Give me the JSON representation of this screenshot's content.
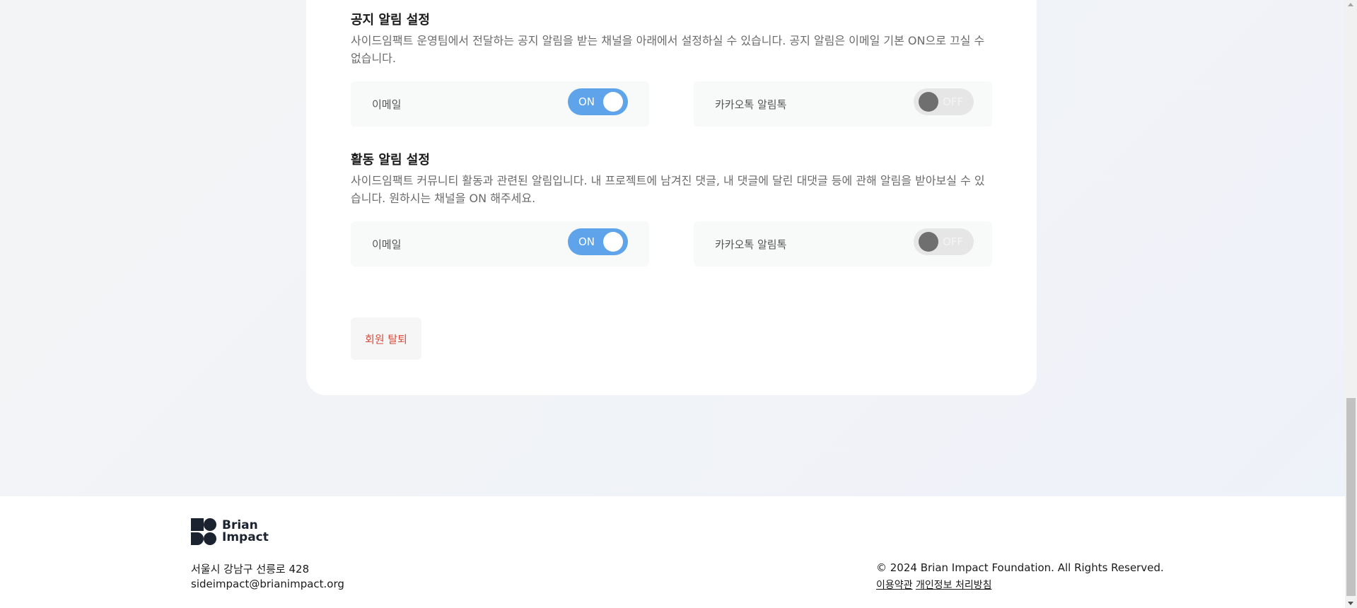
{
  "notice": {
    "title": "공지 알림 설정",
    "desc": "사이드임팩트 운영팀에서 전달하는 공지 알림을 받는 채널을 아래에서 설정하실 수 있습니다. 공지 알림은 이메일 기본 ON으로 끄실 수 없습니다.",
    "email": {
      "label": "이메일",
      "state": "ON"
    },
    "kakao": {
      "label": "카카오톡 알림톡",
      "state": "OFF"
    }
  },
  "activity": {
    "title": "활동 알림 설정",
    "desc": "사이드임팩트 커뮤니티 활동과 관련된 알림입니다. 내 프로젝트에 남겨진 댓글, 내 댓글에 달린 대댓글 등에 관해 알림을 받아보실 수 있습니다. 원하시는 채널을 ON 해주세요.",
    "email": {
      "label": "이메일",
      "state": "ON"
    },
    "kakao": {
      "label": "카카오톡 알림톡",
      "state": "OFF"
    }
  },
  "withdraw_label": "회원 탈퇴",
  "footer": {
    "logo_line1": "Brian",
    "logo_line2": "Impact",
    "address": "서울시 강남구 선릉로 428",
    "email": "sideimpact@brianimpact.org",
    "copyright": "© 2024 Brian Impact Foundation. All Rights Reserved.",
    "terms": "이용약관",
    "privacy": "개인정보 처리방침"
  },
  "colors": {
    "toggle_on": "#5fa3ea",
    "toggle_off": "#e6e6e6",
    "withdraw_text": "#d94a3a"
  }
}
